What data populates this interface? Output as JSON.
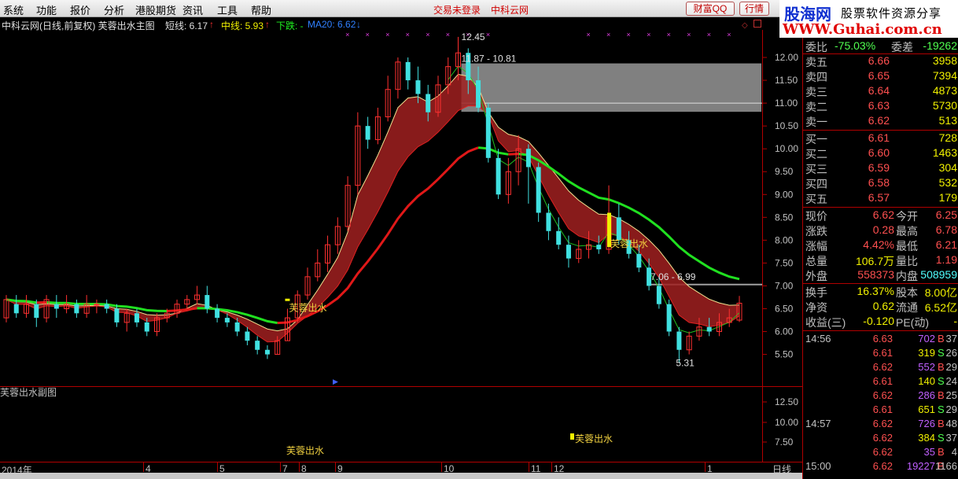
{
  "menu": [
    "系统",
    "功能",
    "报价",
    "分析",
    "港股期货",
    "资讯",
    "工具",
    "帮助"
  ],
  "status_links": [
    "交易未登录",
    "中科云网"
  ],
  "top_buttons": [
    "财富QQ",
    "行情"
  ],
  "watermark": {
    "site": "股海网",
    "slogan": "股票软件资源分享",
    "url": "WWW.Guhai.com.cn"
  },
  "header": {
    "title": "中科云网(日线,前复权) 芙蓉出水主图",
    "short_label": "短线: 6.17",
    "mid_label": "中线: 5.93",
    "down_label": "下跌: -",
    "ma_label": "MA20: 6.62"
  },
  "price_axis": [
    "12.00",
    "11.50",
    "11.00",
    "10.50",
    "10.00",
    "9.50",
    "9.00",
    "8.50",
    "8.00",
    "7.50",
    "7.00",
    "6.50",
    "6.00",
    "5.50"
  ],
  "annotations": {
    "high": "12.45",
    "range_upper": "11.87 - 10.81",
    "range_lower": "7.06 - 6.99",
    "low": "5.31",
    "signal": "芙蓉出水"
  },
  "sub_chart": {
    "title": "芙蓉出水副图",
    "axis": [
      "12.50",
      "10.00",
      "7.50"
    ]
  },
  "x_axis": [
    "2014年",
    "4",
    "5",
    "7",
    "8",
    "9",
    "10",
    "11",
    "12",
    "1"
  ],
  "period": "日线",
  "quote": {
    "ratio": {
      "label": "委比",
      "value": "-75.03%",
      "label2": "委差",
      "value2": "-19262"
    },
    "asks": [
      {
        "label": "卖五",
        "price": "6.66",
        "vol": "3958"
      },
      {
        "label": "卖四",
        "price": "6.65",
        "vol": "7394"
      },
      {
        "label": "卖三",
        "price": "6.64",
        "vol": "4873"
      },
      {
        "label": "卖二",
        "price": "6.63",
        "vol": "5730"
      },
      {
        "label": "卖一",
        "price": "6.62",
        "vol": "513"
      }
    ],
    "bids": [
      {
        "label": "买一",
        "price": "6.61",
        "vol": "728"
      },
      {
        "label": "买二",
        "price": "6.60",
        "vol": "1463"
      },
      {
        "label": "买三",
        "price": "6.59",
        "vol": "304"
      },
      {
        "label": "买四",
        "price": "6.58",
        "vol": "532"
      },
      {
        "label": "买五",
        "price": "6.57",
        "vol": "179"
      }
    ],
    "stats": [
      {
        "l1": "现价",
        "v1": "6.62",
        "l2": "今开",
        "v2": "6.25",
        "c1": "#ff5050",
        "c2": "#ff5050"
      },
      {
        "l1": "涨跌",
        "v1": "0.28",
        "l2": "最高",
        "v2": "6.78",
        "c1": "#ff5050",
        "c2": "#ff5050"
      },
      {
        "l1": "涨幅",
        "v1": "4.42%",
        "l2": "最低",
        "v2": "6.21",
        "c1": "#ff5050",
        "c2": "#ff5050"
      },
      {
        "l1": "总量",
        "v1": "106.7万",
        "l2": "量比",
        "v2": "1.19",
        "c1": "#f0f000",
        "c2": "#ff5050"
      },
      {
        "l1": "外盘",
        "v1": "558373",
        "l2": "内盘",
        "v2": "508959",
        "c1": "#ff5050",
        "c2": "#50ffff"
      },
      {
        "l1": "换手",
        "v1": "16.37%",
        "l2": "股本",
        "v2": "8.00亿",
        "c1": "#f0f000",
        "c2": "#f0f000"
      },
      {
        "l1": "净资",
        "v1": "0.62",
        "l2": "流通",
        "v2": "6.52亿",
        "c1": "#f0f000",
        "c2": "#f0f000"
      },
      {
        "l1": "收益(三)",
        "v1": "-0.120",
        "l2": "PE(动)",
        "v2": "-",
        "c1": "#f0f000",
        "c2": "#f0f000"
      }
    ],
    "ticks": [
      {
        "time": "14:56",
        "price": "6.63",
        "vol": "702",
        "bs": "B",
        "cnt": "37"
      },
      {
        "time": "",
        "price": "6.61",
        "vol": "319",
        "bs": "S",
        "cnt": "26"
      },
      {
        "time": "",
        "price": "6.62",
        "vol": "552",
        "bs": "B",
        "cnt": "29"
      },
      {
        "time": "",
        "price": "6.61",
        "vol": "140",
        "bs": "S",
        "cnt": "24"
      },
      {
        "time": "",
        "price": "6.62",
        "vol": "286",
        "bs": "B",
        "cnt": "25"
      },
      {
        "time": "",
        "price": "6.61",
        "vol": "651",
        "bs": "S",
        "cnt": "29"
      },
      {
        "time": "14:57",
        "price": "6.62",
        "vol": "726",
        "bs": "B",
        "cnt": "48"
      },
      {
        "time": "",
        "price": "6.62",
        "vol": "384",
        "bs": "S",
        "cnt": "37"
      },
      {
        "time": "",
        "price": "6.62",
        "vol": "35",
        "bs": "B",
        "cnt": "4"
      },
      {
        "time": "15:00",
        "price": "6.62",
        "vol": "19227",
        "bs": "B",
        "cnt": "1166"
      }
    ]
  },
  "chart_data": {
    "type": "candlestick",
    "title": "中科云网(日线,前复权) 芙蓉出水主图",
    "xlabel": "",
    "ylabel": "",
    "ylim": [
      5.2,
      12.5
    ],
    "x_ticks": [
      "2014年",
      "4",
      "5",
      "7",
      "8",
      "9",
      "10",
      "11",
      "12",
      "1"
    ],
    "indicators": [
      "MA20",
      "短线",
      "中线"
    ],
    "series": [
      {
        "name": "MA20",
        "values": [
          6.6,
          6.62,
          6.6,
          6.5,
          6.2,
          6.3,
          7.2,
          9.0,
          10.9,
          10.9,
          10.3,
          9.4,
          8.6,
          7.6,
          6.62
        ]
      }
    ],
    "candles": [
      [
        6.3,
        6.7,
        6.2,
        6.8
      ],
      [
        6.6,
        6.4,
        6.3,
        6.8
      ],
      [
        6.4,
        6.6,
        6.3,
        6.8
      ],
      [
        6.6,
        6.3,
        6.1,
        6.7
      ],
      [
        6.3,
        6.7,
        6.2,
        6.8
      ],
      [
        6.6,
        6.5,
        6.3,
        6.8
      ],
      [
        6.5,
        6.6,
        6.4,
        6.8
      ],
      [
        6.6,
        6.4,
        6.3,
        6.7
      ],
      [
        6.4,
        6.6,
        6.3,
        6.8
      ],
      [
        6.6,
        6.6,
        6.4,
        6.7
      ],
      [
        6.6,
        6.5,
        6.4,
        6.7
      ],
      [
        6.5,
        6.2,
        6.1,
        6.6
      ],
      [
        6.2,
        6.4,
        6.0,
        6.5
      ],
      [
        6.4,
        6.2,
        6.1,
        6.5
      ],
      [
        6.2,
        6.0,
        5.9,
        6.3
      ],
      [
        6.0,
        6.3,
        5.9,
        6.4
      ],
      [
        6.3,
        6.4,
        6.2,
        6.5
      ],
      [
        6.4,
        6.6,
        6.3,
        6.7
      ],
      [
        6.6,
        6.7,
        6.5,
        6.8
      ],
      [
        6.7,
        6.8,
        6.6,
        7.0
      ],
      [
        6.8,
        6.5,
        6.4,
        7.0
      ],
      [
        6.5,
        6.3,
        6.2,
        6.6
      ],
      [
        6.3,
        6.2,
        6.1,
        6.4
      ],
      [
        6.2,
        6.0,
        5.9,
        6.3
      ],
      [
        6.0,
        5.8,
        5.7,
        6.1
      ],
      [
        5.8,
        5.6,
        5.5,
        5.9
      ],
      [
        5.6,
        5.5,
        5.4,
        5.7
      ],
      [
        5.5,
        5.8,
        5.5,
        5.9
      ],
      [
        5.8,
        6.3,
        5.8,
        6.5
      ],
      [
        6.3,
        6.8,
        6.2,
        6.9
      ],
      [
        6.8,
        7.2,
        6.7,
        7.4
      ],
      [
        7.2,
        7.5,
        7.1,
        7.8
      ],
      [
        7.5,
        7.9,
        7.3,
        8.1
      ],
      [
        7.9,
        8.3,
        7.7,
        8.5
      ],
      [
        8.3,
        9.2,
        8.2,
        9.4
      ],
      [
        9.2,
        10.5,
        9.0,
        10.8
      ],
      [
        10.5,
        10.2,
        10.0,
        10.7
      ],
      [
        10.2,
        10.7,
        10.1,
        10.9
      ],
      [
        10.7,
        11.3,
        10.6,
        11.6
      ],
      [
        11.3,
        11.9,
        11.1,
        12.0
      ],
      [
        11.9,
        11.5,
        11.3,
        12.0
      ],
      [
        11.5,
        11.2,
        11.0,
        11.8
      ],
      [
        11.2,
        10.8,
        10.6,
        11.4
      ],
      [
        10.8,
        11.4,
        10.7,
        11.6
      ],
      [
        11.4,
        11.8,
        11.2,
        12.0
      ],
      [
        11.8,
        12.1,
        11.5,
        12.45
      ],
      [
        12.1,
        11.5,
        11.2,
        12.2
      ],
      [
        11.5,
        10.9,
        10.8,
        11.8
      ],
      [
        10.9,
        9.8,
        9.7,
        11.0
      ],
      [
        9.8,
        9.0,
        8.9,
        10.0
      ],
      [
        9.0,
        9.5,
        8.8,
        9.8
      ],
      [
        9.5,
        10.0,
        9.2,
        10.3
      ],
      [
        10.0,
        9.6,
        8.8,
        10.1
      ],
      [
        9.6,
        8.6,
        8.4,
        9.7
      ],
      [
        8.6,
        8.2,
        8.0,
        8.8
      ],
      [
        8.2,
        7.9,
        7.8,
        8.5
      ],
      [
        7.9,
        7.6,
        7.4,
        8.1
      ],
      [
        7.6,
        7.8,
        7.5,
        8.0
      ],
      [
        7.8,
        7.9,
        7.6,
        8.2
      ],
      [
        7.9,
        7.8,
        7.7,
        8.1
      ],
      [
        7.8,
        8.5,
        7.7,
        9.2
      ],
      [
        8.5,
        8.0,
        7.9,
        8.8
      ],
      [
        8.0,
        7.7,
        7.6,
        8.2
      ],
      [
        7.7,
        7.4,
        7.3,
        7.9
      ],
      [
        7.4,
        7.0,
        6.9,
        7.6
      ],
      [
        7.0,
        6.6,
        6.5,
        7.2
      ],
      [
        6.6,
        6.0,
        5.9,
        6.7
      ],
      [
        6.0,
        5.6,
        5.31,
        6.1
      ],
      [
        5.6,
        5.9,
        5.5,
        6.0
      ],
      [
        5.9,
        6.1,
        5.8,
        6.3
      ],
      [
        6.1,
        6.0,
        5.9,
        6.3
      ],
      [
        6.0,
        6.2,
        5.9,
        6.4
      ],
      [
        6.2,
        6.3,
        6.1,
        6.5
      ],
      [
        6.25,
        6.62,
        6.21,
        6.78
      ]
    ]
  }
}
